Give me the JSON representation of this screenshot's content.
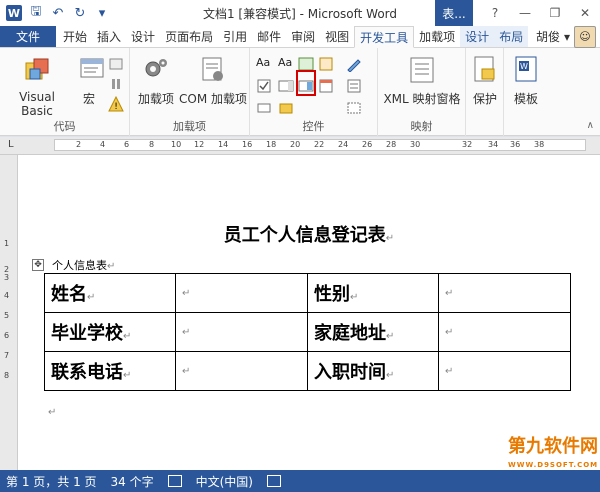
{
  "window": {
    "title": "文档1 [兼容模式] - Microsoft Word",
    "context_tab_title": "表...",
    "help": "?",
    "minimize": "—",
    "restore": "❐",
    "close": "✕"
  },
  "tabs": [
    {
      "label": "文件"
    },
    {
      "label": "开始"
    },
    {
      "label": "插入"
    },
    {
      "label": "设计"
    },
    {
      "label": "页面布局"
    },
    {
      "label": "引用"
    },
    {
      "label": "邮件"
    },
    {
      "label": "审阅"
    },
    {
      "label": "视图"
    },
    {
      "label": "开发工具"
    },
    {
      "label": "加载项"
    },
    {
      "label": "设计"
    },
    {
      "label": "布局"
    }
  ],
  "user": {
    "name": "胡俊",
    "dropdown": "▾"
  },
  "ribbon": {
    "groups": {
      "code": "代码",
      "addins": "加载项",
      "controls": "控件",
      "mapping": "映射"
    },
    "buttons": {
      "visual_basic": "Visual Basic",
      "macros": "宏",
      "addins": "加载项",
      "com_addins": "COM 加载项",
      "xml_mapping": "XML 映射窗格",
      "protect": "保护",
      "template": "模板"
    }
  },
  "ruler": {
    "h_numbers": [
      "L",
      "2",
      "4",
      "6",
      "8",
      "10",
      "12",
      "14",
      "16",
      "18",
      "20",
      "22",
      "24",
      "26",
      "28",
      "30",
      "32",
      "34",
      "36",
      "38"
    ],
    "v_numbers": [
      "1",
      "2",
      "3",
      "4",
      "5",
      "6",
      "7",
      "8"
    ]
  },
  "document": {
    "title": "员工个人信息登记表",
    "table_caption": "个人信息表",
    "pilcrow": "↵",
    "rows": [
      [
        "姓名",
        "",
        "性别",
        ""
      ],
      [
        "毕业学校",
        "",
        "家庭地址",
        ""
      ],
      [
        "联系电话",
        "",
        "入职时间",
        ""
      ]
    ]
  },
  "status": {
    "page": "第 1 页，共 1 页",
    "words": "34 个字",
    "language": "中文(中国)"
  },
  "watermark": {
    "main": "第九软件网",
    "sub": "WWW.D9SOFT.COM"
  },
  "colors": {
    "accent": "#2b579a",
    "highlight": "#d60000"
  }
}
